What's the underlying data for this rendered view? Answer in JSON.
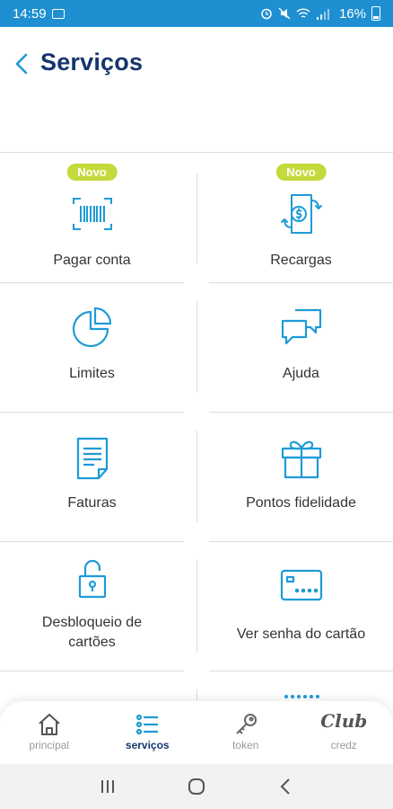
{
  "status_bar": {
    "time": "14:59",
    "battery": "16%"
  },
  "header": {
    "title": "Serviços"
  },
  "badge_new": "Novo",
  "services": [
    {
      "label": "Pagar conta",
      "icon": "barcode-scan-icon",
      "badge": "Novo"
    },
    {
      "label": "Recargas",
      "icon": "recharge-icon",
      "badge": "Novo"
    },
    {
      "label": "Limites",
      "icon": "pie-chart-icon"
    },
    {
      "label": "Ajuda",
      "icon": "chat-bubbles-icon"
    },
    {
      "label": "Faturas",
      "icon": "document-icon"
    },
    {
      "label": "Pontos fidelidade",
      "icon": "gift-icon"
    },
    {
      "label": "Desbloqueio de cartões",
      "icon": "unlock-icon"
    },
    {
      "label": "Ver senha do cartão",
      "icon": "card-password-icon"
    }
  ],
  "bottom_nav": [
    {
      "label": "principal",
      "icon": "home-icon",
      "active": false
    },
    {
      "label": "serviços",
      "icon": "list-icon",
      "active": true
    },
    {
      "label": "token",
      "icon": "key-icon",
      "active": false
    },
    {
      "label": "credz",
      "icon": "club-logo",
      "logo_text": "Club",
      "active": false
    }
  ],
  "colors": {
    "accent": "#1e9bd7",
    "title": "#16356e",
    "badge": "#c4d93c",
    "status_bar": "#1e8fd0"
  }
}
